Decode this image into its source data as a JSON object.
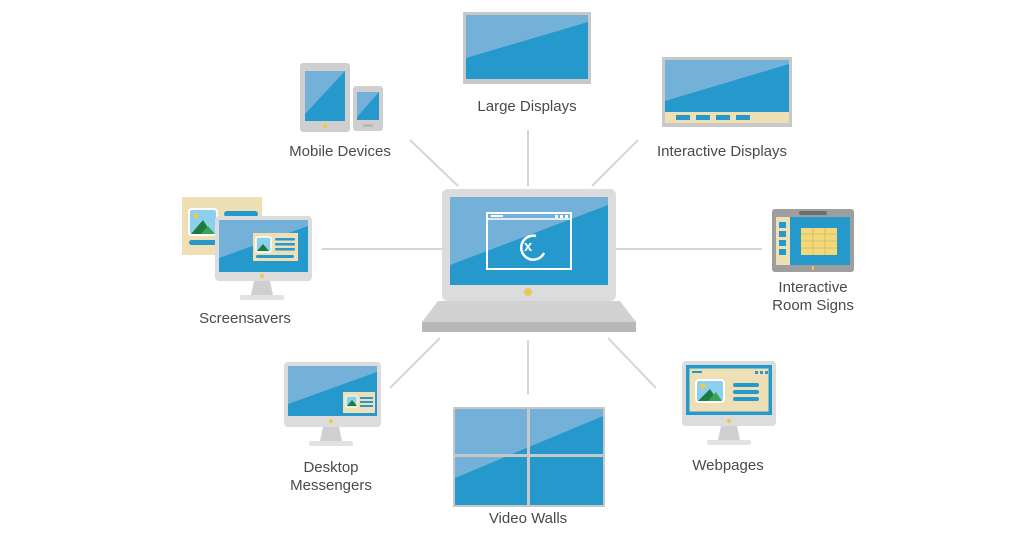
{
  "colors": {
    "screen_blue": "#2699cc",
    "screen_highlight": "#74b1d9",
    "bezel_gray": "#c8c8c8",
    "bezel_dark": "#9e9e9e",
    "cream": "#efdfb5",
    "line_gray": "#d6d6d6",
    "text_gray": "#4a4a4a",
    "led_yellow": "#f5c842",
    "leaf_dark": "#1e7a3d",
    "leaf_green": "#3aa455",
    "sky_blue": "#8dd0ee"
  },
  "center": {
    "name": "laptop-hub",
    "icon": "laptop-app-window-icon"
  },
  "nodes": [
    {
      "id": "large-displays",
      "label": "Large Displays",
      "icon": "large-display-icon"
    },
    {
      "id": "interactive-displays",
      "label": "Interactive Displays",
      "icon": "interactive-display-icon"
    },
    {
      "id": "interactive-room-signs",
      "label": "Interactive\nRoom Signs",
      "icon": "room-sign-icon"
    },
    {
      "id": "webpages",
      "label": "Webpages",
      "icon": "webpage-monitor-icon"
    },
    {
      "id": "video-walls",
      "label": "Video Walls",
      "icon": "video-wall-icon"
    },
    {
      "id": "desktop-messengers",
      "label": "Desktop\nMessengers",
      "icon": "desktop-messenger-icon"
    },
    {
      "id": "screensavers",
      "label": "Screensavers",
      "icon": "screensaver-icon"
    },
    {
      "id": "mobile-devices",
      "label": "Mobile Devices",
      "icon": "mobile-devices-icon"
    }
  ]
}
